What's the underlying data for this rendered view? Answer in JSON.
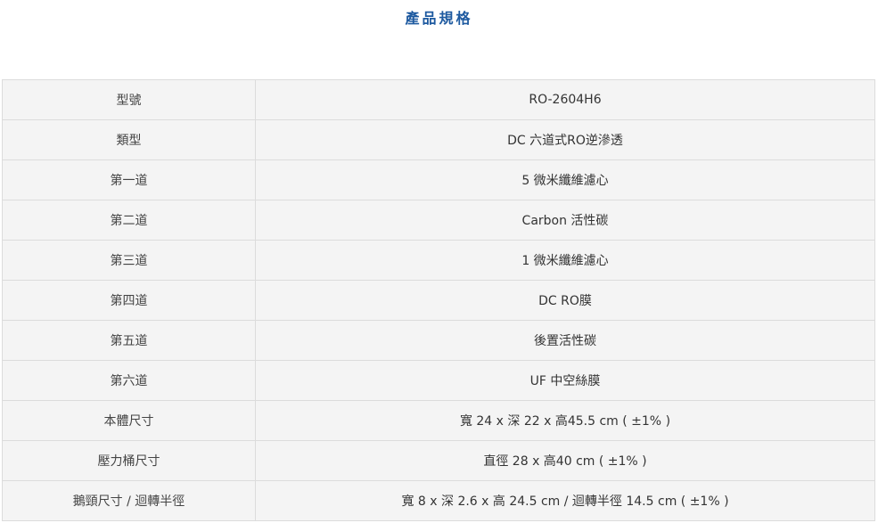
{
  "page": {
    "title": "產品規格"
  },
  "spec_table": {
    "rows": [
      {
        "label": "型號",
        "value": "RO-2604H6"
      },
      {
        "label": "類型",
        "value": "DC 六道式RO逆滲透"
      },
      {
        "label": "第一道",
        "value": "5 微米纖維濾心"
      },
      {
        "label": "第二道",
        "value": "Carbon 活性碳"
      },
      {
        "label": "第三道",
        "value": "1 微米纖維濾心"
      },
      {
        "label": "第四道",
        "value": "DC RO膜"
      },
      {
        "label": "第五道",
        "value": "後置活性碳"
      },
      {
        "label": "第六道",
        "value": "UF 中空絲膜"
      },
      {
        "label": "本體尺寸",
        "value": "寬 24 x 深 22 x 高45.5 cm ( ±1% )"
      },
      {
        "label": "壓力桶尺寸",
        "value": "直徑 28 x 高40 cm ( ±1% )"
      },
      {
        "label": "鵝頸尺寸 / 迴轉半徑",
        "value": "寬 8 x 深 2.6 x 高 24.5 cm / 迴轉半徑 14.5 cm ( ±1% )"
      }
    ]
  },
  "colors": {
    "title": "#1e5aa0",
    "table_bg": "#f4f4f4",
    "border": "#dcdcdc",
    "text": "#333333"
  }
}
